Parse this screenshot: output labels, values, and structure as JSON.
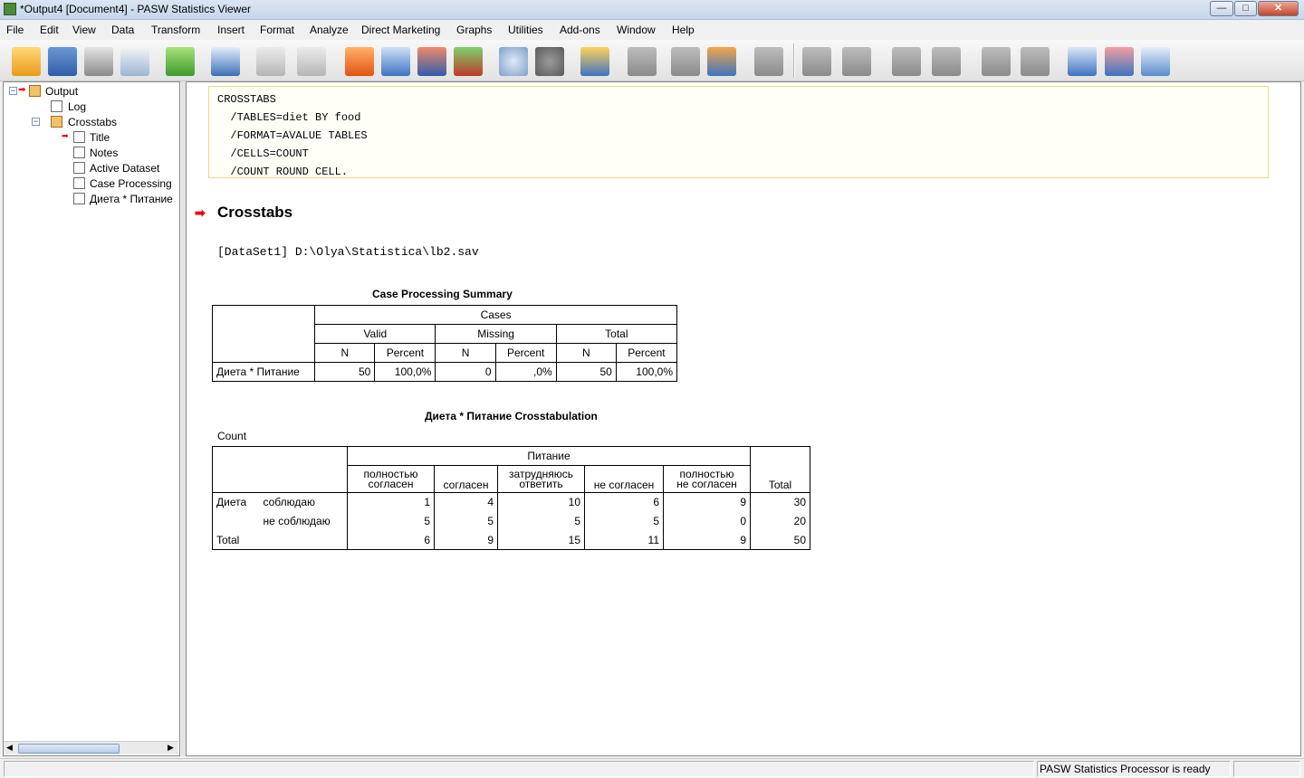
{
  "window": {
    "title": "*Output4 [Document4] - PASW Statistics Viewer",
    "minimize": "—",
    "maximize": "□",
    "close": "✕"
  },
  "menu": [
    "File",
    "Edit",
    "View",
    "Data",
    "Transform",
    "Insert",
    "Format",
    "Analyze",
    "Direct Marketing",
    "Graphs",
    "Utilities",
    "Add-ons",
    "Window",
    "Help"
  ],
  "toolbar_icons": [
    "open-icon",
    "save-icon",
    "print-icon",
    "print-preview-icon",
    "export-icon",
    "recall-dialog-icon",
    "undo-icon",
    "redo-icon",
    "goto-case-icon",
    "goto-variable-icon",
    "insert-cases-icon",
    "variables-icon",
    "split-file-icon",
    "weight-cases-icon",
    "select-cases-icon",
    "value-labels-icon",
    "designate-window-icon",
    "show-all-icon",
    "use-sets-icon",
    "run-icon",
    "back-icon",
    "forward-icon",
    "expand-icon",
    "collapse-icon",
    "show-icon",
    "hide-icon",
    "insert-heading-icon",
    "insert-title-icon",
    "insert-text-icon"
  ],
  "tree": {
    "output": "Output",
    "log": "Log",
    "crosstabs": "Crosstabs",
    "title": "Title",
    "notes": "Notes",
    "active_dataset": "Active Dataset",
    "case_processing": "Case Processing",
    "table": "Диета * Питание"
  },
  "syntax": "CROSSTABS\n  /TABLES=diet BY food\n  /FORMAT=AVALUE TABLES\n  /CELLS=COUNT\n  /COUNT ROUND CELL.",
  "heading": "Crosstabs",
  "dataset": "[DataSet1] D:\\Olya\\Statistica\\lb2.sav",
  "cps": {
    "title": "Case Processing Summary",
    "cases": "Cases",
    "groups": [
      "Valid",
      "Missing",
      "Total"
    ],
    "sub": [
      "N",
      "Percent",
      "N",
      "Percent",
      "N",
      "Percent"
    ],
    "row_label": "Диета * Питание",
    "values": [
      "50",
      "100,0%",
      "0",
      ",0%",
      "50",
      "100,0%"
    ]
  },
  "xtab": {
    "title": "Диета * Питание Crosstabulation",
    "count_label": "Count",
    "col_var": "Питание",
    "cols": [
      "полностью\nсогласен",
      "согласен",
      "затрудняюсь\nответить",
      "не согласен",
      "полностью\nне согласен"
    ],
    "total_label": "Total",
    "row_var": "Диета",
    "rows": [
      {
        "label": "соблюдаю",
        "values": [
          "1",
          "4",
          "10",
          "6",
          "9",
          "30"
        ]
      },
      {
        "label": "не соблюдаю",
        "values": [
          "5",
          "5",
          "5",
          "5",
          "0",
          "20"
        ]
      }
    ],
    "total_row": {
      "label": "Total",
      "values": [
        "6",
        "9",
        "15",
        "11",
        "9",
        "50"
      ]
    }
  },
  "status": "PASW Statistics Processor is ready"
}
